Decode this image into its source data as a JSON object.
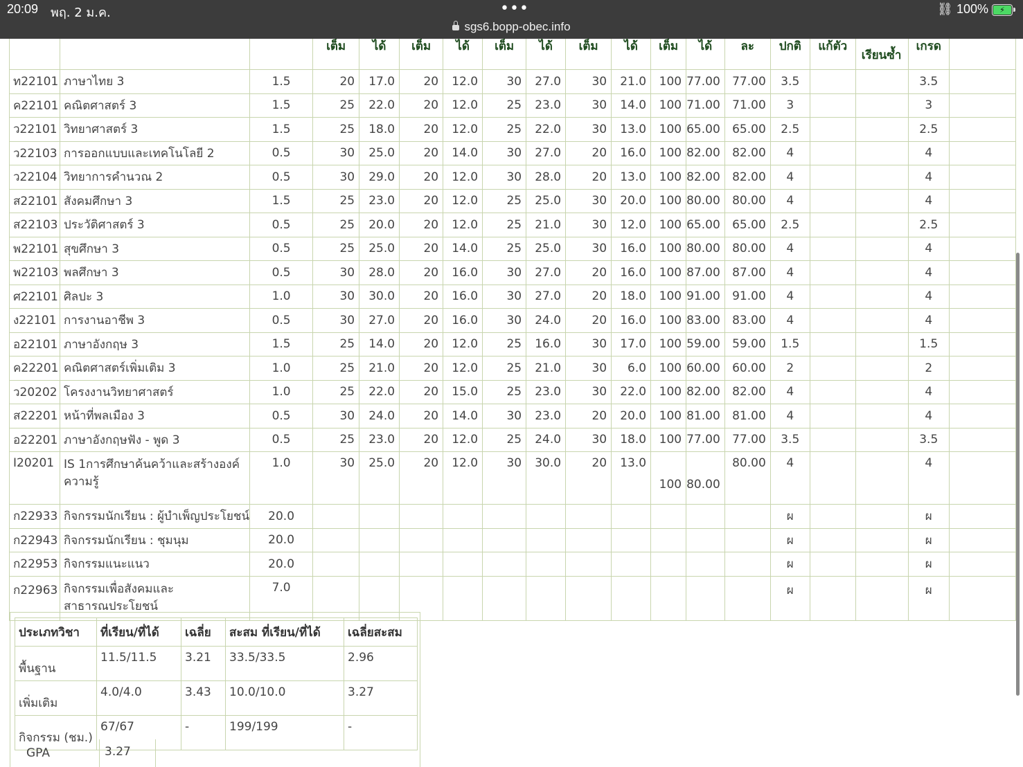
{
  "status_bar": {
    "time": "20:09",
    "date": "พฤ. 2 ม.ค.",
    "dots": "•••",
    "url": "sgs6.bopp-obec.info",
    "battery_text": "100%",
    "battery_color": "#4cd964"
  },
  "grades_table": {
    "headers": [
      "",
      "",
      "",
      "เต็ม",
      "ได้",
      "เต็ม",
      "ได้",
      "เต็ม",
      "ได้",
      "เต็ม",
      "ได้",
      "เต็ม",
      "ได้",
      "ละ",
      "ปกติ",
      "แก้ตัว",
      "เรียนซ้ำ",
      "เกรด",
      ""
    ],
    "rows": [
      [
        "ท22101",
        "ภาษาไทย 3",
        "1.5",
        "20",
        "17.0",
        "20",
        "12.0",
        "30",
        "27.0",
        "30",
        "21.0",
        "100",
        "77.00",
        "77.00",
        "3.5",
        "",
        "",
        "3.5",
        ""
      ],
      [
        "ค22101",
        "คณิตศาสตร์ 3",
        "1.5",
        "25",
        "22.0",
        "20",
        "12.0",
        "25",
        "23.0",
        "30",
        "14.0",
        "100",
        "71.00",
        "71.00",
        "3",
        "",
        "",
        "3",
        ""
      ],
      [
        "ว22101",
        "วิทยาศาสตร์ 3",
        "1.5",
        "25",
        "18.0",
        "20",
        "12.0",
        "25",
        "22.0",
        "30",
        "13.0",
        "100",
        "65.00",
        "65.00",
        "2.5",
        "",
        "",
        "2.5",
        ""
      ],
      [
        "ว22103",
        "การออกแบบและเทคโนโลยี 2",
        "0.5",
        "30",
        "25.0",
        "20",
        "14.0",
        "30",
        "27.0",
        "20",
        "16.0",
        "100",
        "82.00",
        "82.00",
        "4",
        "",
        "",
        "4",
        ""
      ],
      [
        "ว22104",
        "วิทยาการคำนวณ 2",
        "0.5",
        "30",
        "29.0",
        "20",
        "12.0",
        "30",
        "28.0",
        "20",
        "13.0",
        "100",
        "82.00",
        "82.00",
        "4",
        "",
        "",
        "4",
        ""
      ],
      [
        "ส22101",
        "สังคมศึกษา 3",
        "1.5",
        "25",
        "23.0",
        "20",
        "12.0",
        "25",
        "25.0",
        "30",
        "20.0",
        "100",
        "80.00",
        "80.00",
        "4",
        "",
        "",
        "4",
        ""
      ],
      [
        "ส22103",
        "ประวัติศาสตร์ 3",
        "0.5",
        "25",
        "20.0",
        "20",
        "12.0",
        "25",
        "21.0",
        "30",
        "12.0",
        "100",
        "65.00",
        "65.00",
        "2.5",
        "",
        "",
        "2.5",
        ""
      ],
      [
        "พ22101",
        "สุขศึกษา 3",
        "0.5",
        "25",
        "25.0",
        "20",
        "14.0",
        "25",
        "25.0",
        "30",
        "16.0",
        "100",
        "80.00",
        "80.00",
        "4",
        "",
        "",
        "4",
        ""
      ],
      [
        "พ22103",
        "พลศึกษา 3",
        "0.5",
        "30",
        "28.0",
        "20",
        "16.0",
        "30",
        "27.0",
        "20",
        "16.0",
        "100",
        "87.00",
        "87.00",
        "4",
        "",
        "",
        "4",
        ""
      ],
      [
        "ศ22101",
        "ศิลปะ 3",
        "1.0",
        "30",
        "30.0",
        "20",
        "16.0",
        "30",
        "27.0",
        "20",
        "18.0",
        "100",
        "91.00",
        "91.00",
        "4",
        "",
        "",
        "4",
        ""
      ],
      [
        "ง22101",
        "การงานอาชีพ 3",
        "0.5",
        "30",
        "27.0",
        "20",
        "16.0",
        "30",
        "24.0",
        "20",
        "16.0",
        "100",
        "83.00",
        "83.00",
        "4",
        "",
        "",
        "4",
        ""
      ],
      [
        "อ22101",
        "ภาษาอังกฤษ 3",
        "1.5",
        "25",
        "14.0",
        "20",
        "12.0",
        "25",
        "16.0",
        "30",
        "17.0",
        "100",
        "59.00",
        "59.00",
        "1.5",
        "",
        "",
        "1.5",
        ""
      ],
      [
        "ค22201",
        "คณิตศาสตร์เพิ่มเติม 3",
        "1.0",
        "25",
        "21.0",
        "20",
        "12.0",
        "25",
        "21.0",
        "30",
        "6.0",
        "100",
        "60.00",
        "60.00",
        "2",
        "",
        "",
        "2",
        ""
      ],
      [
        "ว20202",
        "โครงงานวิทยาศาสตร์",
        "1.0",
        "25",
        "22.0",
        "20",
        "15.0",
        "25",
        "23.0",
        "30",
        "22.0",
        "100",
        "82.00",
        "82.00",
        "4",
        "",
        "",
        "4",
        ""
      ],
      [
        "ส22201",
        "หน้าที่พลเมือง 3",
        "0.5",
        "30",
        "24.0",
        "20",
        "14.0",
        "30",
        "23.0",
        "20",
        "20.0",
        "100",
        "81.00",
        "81.00",
        "4",
        "",
        "",
        "4",
        ""
      ],
      [
        "อ22201",
        "ภาษาอังกฤษฟัง - พูด 3",
        "0.5",
        "25",
        "23.0",
        "20",
        "12.0",
        "25",
        "24.0",
        "30",
        "18.0",
        "100",
        "77.00",
        "77.00",
        "3.5",
        "",
        "",
        "3.5",
        ""
      ],
      [
        "I20201",
        "IS 1การศึกษาค้นคว้าและสร้างองค์ความรู้",
        "1.0",
        "30",
        "25.0",
        "20",
        "12.0",
        "30",
        "30.0",
        "20",
        "13.0",
        "100",
        "80.00",
        "80.00",
        "4",
        "",
        "",
        "4",
        ""
      ],
      [
        "ก22933",
        "กิจกรรมนักเรียน : ผู้บำเพ็ญประโยชน์",
        "20.0",
        "",
        "",
        "",
        "",
        "",
        "",
        "",
        "",
        "",
        "",
        "",
        "ผ",
        "",
        "",
        "ผ",
        ""
      ],
      [
        "ก22943",
        "กิจกรรมนักเรียน : ชุมนุม",
        "20.0",
        "",
        "",
        "",
        "",
        "",
        "",
        "",
        "",
        "",
        "",
        "",
        "ผ",
        "",
        "",
        "ผ",
        ""
      ],
      [
        "ก22953",
        "กิจกรรมแนะแนว",
        "20.0",
        "",
        "",
        "",
        "",
        "",
        "",
        "",
        "",
        "",
        "",
        "",
        "ผ",
        "",
        "",
        "ผ",
        ""
      ],
      [
        "ก22963",
        "กิจกรรมเพื่อสังคมและสาธารณประโยชน์",
        "7.0",
        "",
        "",
        "",
        "",
        "",
        "",
        "",
        "",
        "",
        "",
        "",
        "ผ",
        "",
        "",
        "ผ",
        ""
      ]
    ]
  },
  "summary": {
    "headers": [
      "ประเภทวิชา",
      "ที่เรียน/ที่ได้",
      "เฉลี่ย",
      "สะสม ที่เรียน/ที่ได้",
      "เฉลี่ยสะสม"
    ],
    "rows": [
      [
        "พื้นฐาน",
        "11.5/11.5",
        "3.21",
        "33.5/33.5",
        "2.96"
      ],
      [
        "เพิ่มเติม",
        "4.0/4.0",
        "3.43",
        "10.0/10.0",
        "3.27"
      ],
      [
        "กิจกรรม (ชม.)",
        "67/67",
        "-",
        "199/199",
        "-"
      ]
    ],
    "gpa_label": "GPA",
    "gpa_value": "3.27"
  }
}
